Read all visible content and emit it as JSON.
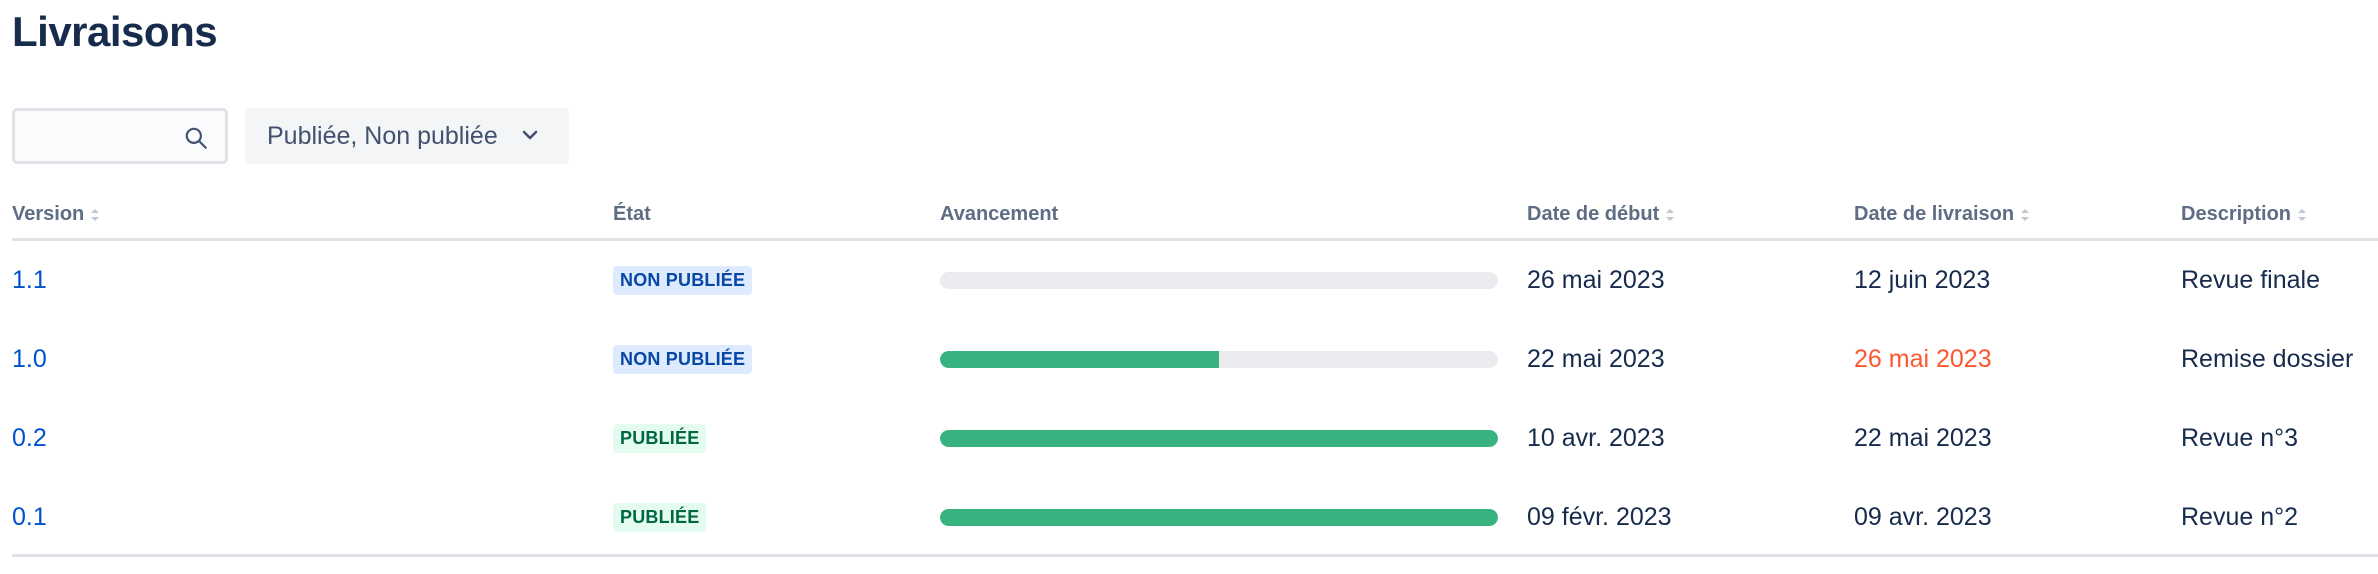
{
  "page": {
    "title": "Livraisons"
  },
  "toolbar": {
    "search_value": "",
    "filter_label": "Publiée, Non publiée"
  },
  "table": {
    "columns": {
      "version": "Version",
      "state": "État",
      "progress": "Avancement",
      "start": "Date de début",
      "release": "Date de livraison",
      "description": "Description"
    },
    "rows": [
      {
        "version": "1.1",
        "state": "NON PUBLIÉE",
        "released": false,
        "progress": 0,
        "start": "26 mai 2023",
        "release": "12 juin 2023",
        "release_late": false,
        "description": "Revue finale"
      },
      {
        "version": "1.0",
        "state": "NON PUBLIÉE",
        "released": false,
        "progress": 0.5,
        "start": "22 mai 2023",
        "release": "26 mai 2023",
        "release_late": true,
        "description": "Remise dossier"
      },
      {
        "version": "0.2",
        "state": "PUBLIÉE",
        "released": true,
        "progress": 1,
        "start": "10 avr. 2023",
        "release": "22 mai 2023",
        "release_late": false,
        "description": "Revue n°3"
      },
      {
        "version": "0.1",
        "state": "PUBLIÉE",
        "released": true,
        "progress": 1,
        "start": "09 févr. 2023",
        "release": "09 avr. 2023",
        "release_late": false,
        "description": "Revue n°2"
      }
    ]
  },
  "colors": {
    "link": "#0052cc",
    "progress_fill": "#36b37e",
    "late": "#ff5630"
  }
}
